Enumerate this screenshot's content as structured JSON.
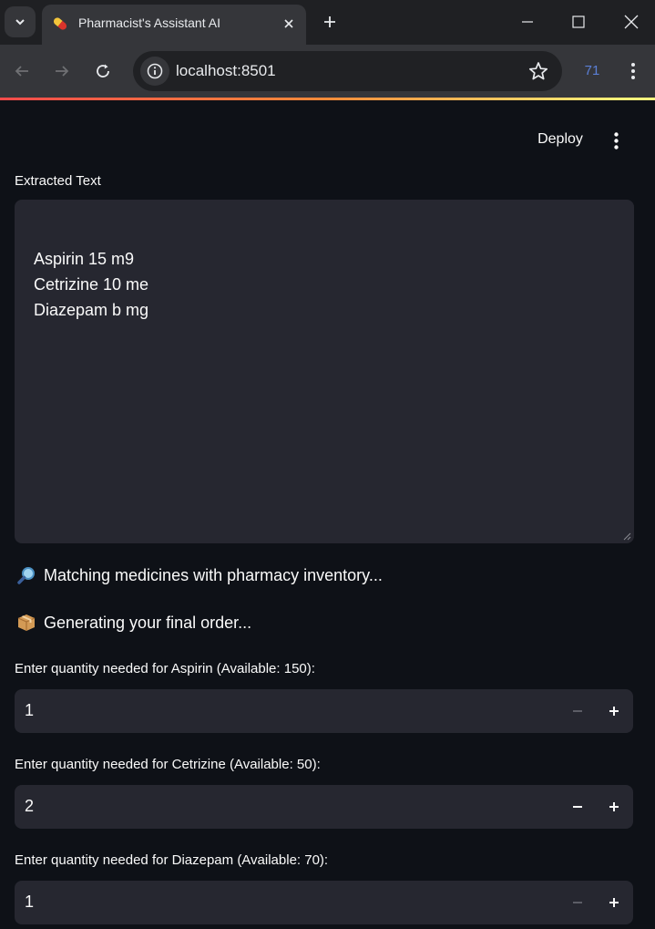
{
  "browser": {
    "tab_title": "Pharmacist's Assistant AI",
    "url": "localhost:8501",
    "extension_badge": "71"
  },
  "header": {
    "deploy_label": "Deploy"
  },
  "extracted": {
    "label": "Extracted Text",
    "text": "Aspirin 15 m9\nCetrizine 10 me\nDiazepam b mg"
  },
  "status": [
    {
      "icon": "magnifier-emoji",
      "text": "Matching medicines with pharmacy inventory..."
    },
    {
      "icon": "package-emoji",
      "text": "Generating your final order..."
    }
  ],
  "quantities": [
    {
      "label": "Enter quantity needed for Aspirin (Available: 150):",
      "value": "1",
      "minus_enabled": false
    },
    {
      "label": "Enter quantity needed for Cetrizine (Available: 50):",
      "value": "2",
      "minus_enabled": true
    },
    {
      "label": "Enter quantity needed for Diazepam (Available: 70):",
      "value": "1",
      "minus_enabled": false
    }
  ],
  "colors": {
    "background": "#0e1117",
    "input_bg": "#262730",
    "accent": "#ff4b4b"
  }
}
